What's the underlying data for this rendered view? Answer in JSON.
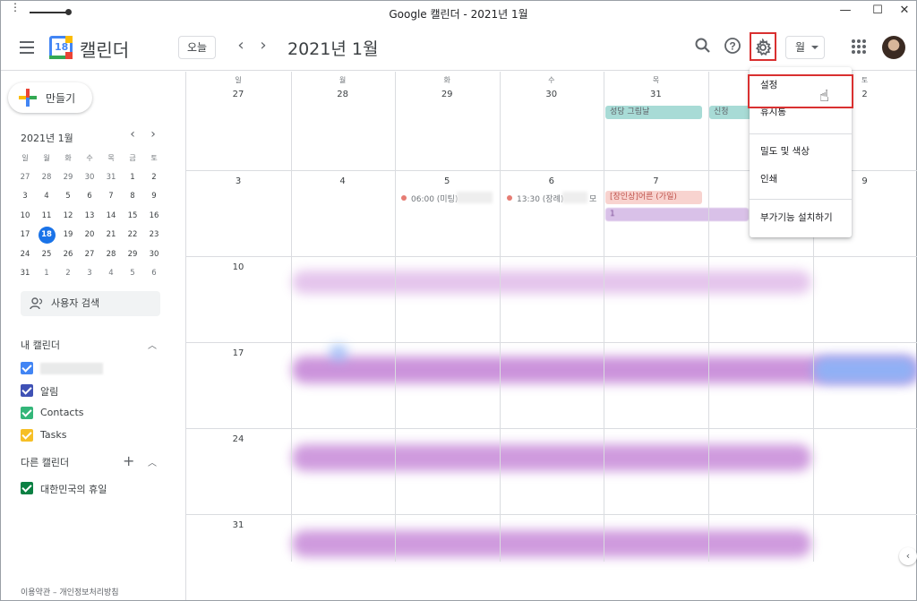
{
  "window": {
    "title": "Google 캘린더 - 2021년 1월",
    "menu_dots": "⋮",
    "minimize": "—",
    "maximize": "☐",
    "close": "✕"
  },
  "header": {
    "app_name": "캘린더",
    "logo_day": "18",
    "today_label": "오늘",
    "prev": "‹",
    "next": "›",
    "current_period": "2021년 1월",
    "view_label": "월"
  },
  "sidebar": {
    "create_label": "만들기",
    "mini_month_title": "2021년 1월",
    "mini_prev": "‹",
    "mini_next": "›",
    "weekday_headers": [
      "일",
      "월",
      "화",
      "수",
      "목",
      "금",
      "토"
    ],
    "mini_weeks": [
      [
        "27",
        "28",
        "29",
        "30",
        "31",
        "1",
        "2"
      ],
      [
        "3",
        "4",
        "5",
        "6",
        "7",
        "8",
        "9"
      ],
      [
        "10",
        "11",
        "12",
        "13",
        "14",
        "15",
        "16"
      ],
      [
        "17",
        "18",
        "19",
        "20",
        "21",
        "22",
        "23"
      ],
      [
        "24",
        "25",
        "26",
        "27",
        "28",
        "29",
        "30"
      ],
      [
        "31",
        "1",
        "2",
        "3",
        "4",
        "5",
        "6"
      ]
    ],
    "today": "18",
    "people_search": "사용자 검색",
    "my_calendars_title": "내 캘린더",
    "my_calendars": [
      {
        "label": "",
        "color": "#4285f4"
      },
      {
        "label": "알림",
        "color": "#3f51b5"
      },
      {
        "label": "Contacts",
        "color": "#33b679"
      },
      {
        "label": "Tasks",
        "color": "#f6bf26"
      }
    ],
    "other_calendars_title": "다른 캘린더",
    "other_calendars": [
      {
        "label": "대한민국의 휴일",
        "color": "#0b8043"
      }
    ],
    "footer": "이용약관 – 개인정보처리방침"
  },
  "grid": {
    "weekday_headers": [
      "일",
      "월",
      "화",
      "수",
      "목",
      "금",
      "토"
    ],
    "weeks": [
      [
        "27",
        "28",
        "29",
        "30",
        "31",
        "1",
        "2"
      ],
      [
        "3",
        "4",
        "5",
        "6",
        "7",
        "8",
        "9"
      ],
      [
        "10",
        "",
        "",
        "",
        "",
        "",
        ""
      ],
      [
        "17",
        "",
        "",
        "",
        "",
        "",
        ""
      ],
      [
        "24",
        "",
        "",
        "",
        "",
        "",
        ""
      ],
      [
        "31",
        "",
        "",
        "",
        "",
        "",
        ""
      ]
    ],
    "events": {
      "e1": "성당 그림날",
      "e2": "신청",
      "e3": "06:00 (미팅)",
      "e4": "13:30 (장례)",
      "e4_suffix": "모",
      "e5": "[장인상]어른 (가일)",
      "e6": "1"
    },
    "colors": {
      "teal_event": "#a8dbd6",
      "pink_event": "#f8d3cf",
      "purple_event": "#d9c1e8",
      "blur_purple": "#c57fd6",
      "blur_blue": "#8ab4f8"
    }
  },
  "settings_menu": {
    "items": [
      "설정",
      "휴지통",
      "밀도 및 색상",
      "인쇄",
      "부가기능 설치하기"
    ]
  },
  "side_chevron": "‹"
}
